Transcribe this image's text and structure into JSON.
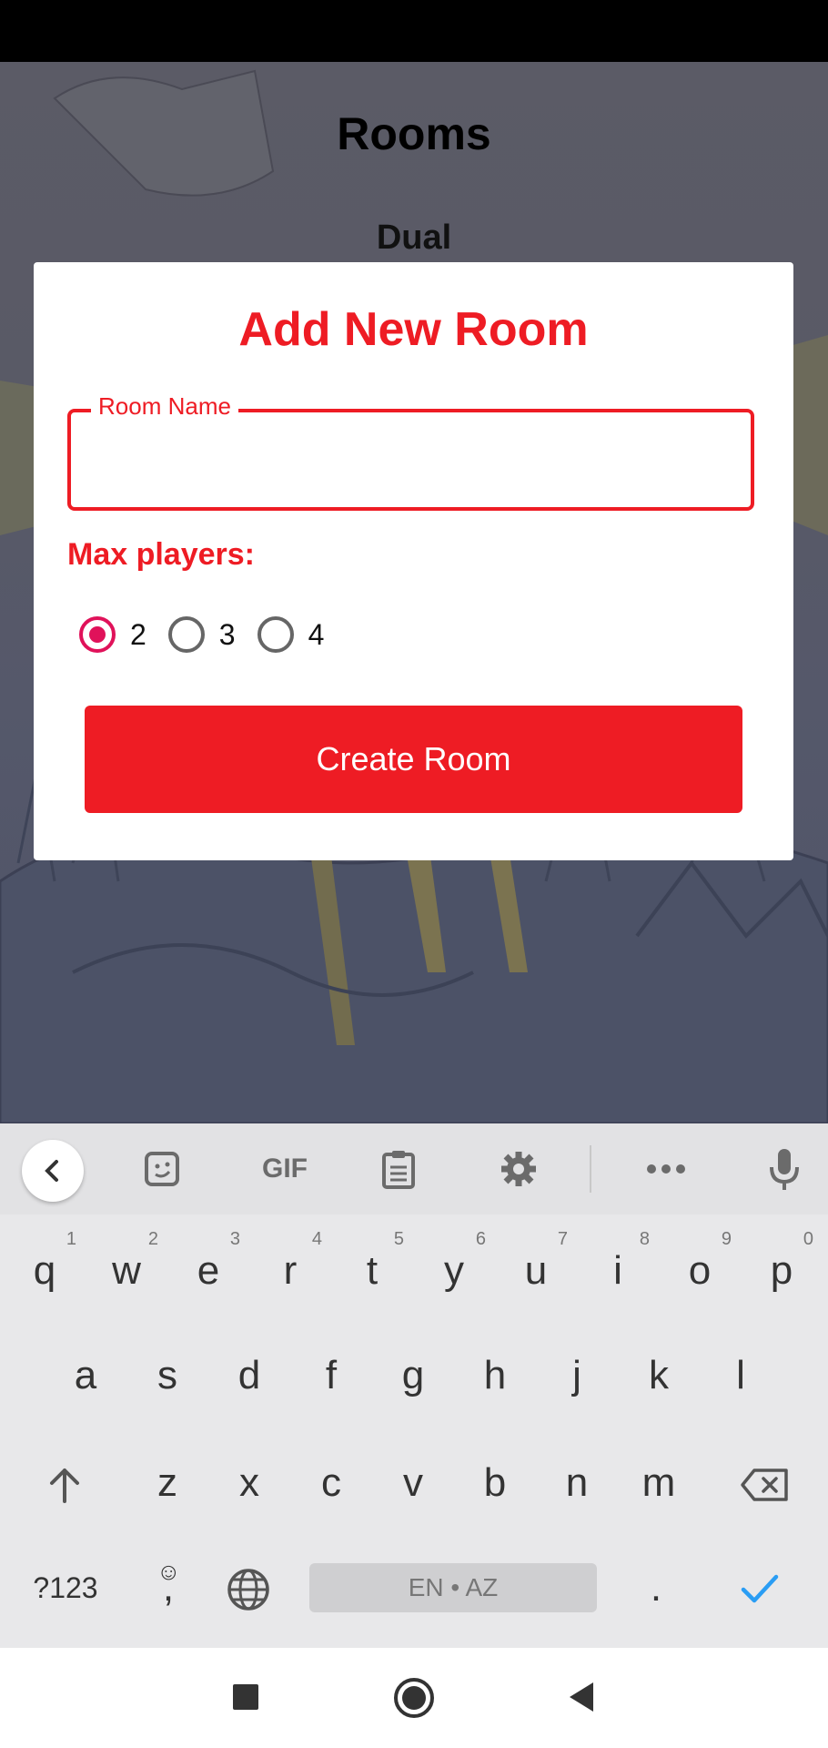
{
  "screen": {
    "page_title": "Rooms",
    "section_title": "Dual"
  },
  "dialog": {
    "title": "Add New Room",
    "room_name_label": "Room Name",
    "room_name_value": "",
    "max_players_label": "Max players:",
    "options": [
      {
        "label": "2",
        "selected": true
      },
      {
        "label": "3",
        "selected": false
      },
      {
        "label": "4",
        "selected": false
      }
    ],
    "create_button": "Create Room"
  },
  "keyboard": {
    "toolbar": {
      "gif": "GIF",
      "icons": [
        "back-icon",
        "sticker-icon",
        "gif-icon",
        "clipboard-icon",
        "settings-icon",
        "more-icon",
        "mic-icon"
      ]
    },
    "row1": [
      "q",
      "w",
      "e",
      "r",
      "t",
      "y",
      "u",
      "i",
      "o",
      "p"
    ],
    "row1_numbers": [
      "1",
      "2",
      "3",
      "4",
      "5",
      "6",
      "7",
      "8",
      "9",
      "0"
    ],
    "row2": [
      "a",
      "s",
      "d",
      "f",
      "g",
      "h",
      "j",
      "k",
      "l"
    ],
    "row3": [
      "z",
      "x",
      "c",
      "v",
      "b",
      "n",
      "m"
    ],
    "symbols_key": "?123",
    "comma_key": ",",
    "period_key": ".",
    "space_label": "EN • AZ"
  },
  "colors": {
    "accent": "#ee1c24",
    "radio_selected": "#e0125a",
    "check": "#2a9df4"
  }
}
